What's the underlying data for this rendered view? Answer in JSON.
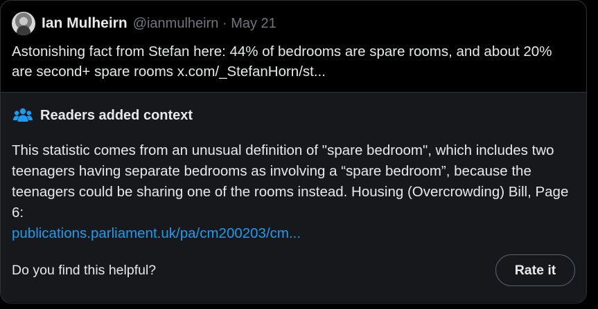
{
  "tweet": {
    "author_name": "Ian Mulheirn",
    "author_handle": "@ianmulheirn",
    "separator": "·",
    "date": "May 21",
    "text": "Astonishing fact from Stefan here: 44% of bedrooms are spare rooms, and about 20% are second+ spare rooms x.com/_StefanHorn/st..."
  },
  "context": {
    "icon": "people-group-icon",
    "title": "Readers added context",
    "body": "This statistic comes from an unusual definition of \"spare bedroom\", which includes two teenagers having separate bedrooms as involving a “spare bedroom”, because the teenagers could be sharing one of the rooms instead. Housing (Overcrowding) Bill, Page 6:",
    "link_text": "publications.parliament.uk/pa/cm200203/cm..."
  },
  "helpful": {
    "question": "Do you find this helpful?",
    "button_label": "Rate it"
  },
  "colors": {
    "link": "#1d9bf0",
    "text": "#e7e9ea",
    "muted": "#71767b",
    "context_bg": "#16181c"
  }
}
